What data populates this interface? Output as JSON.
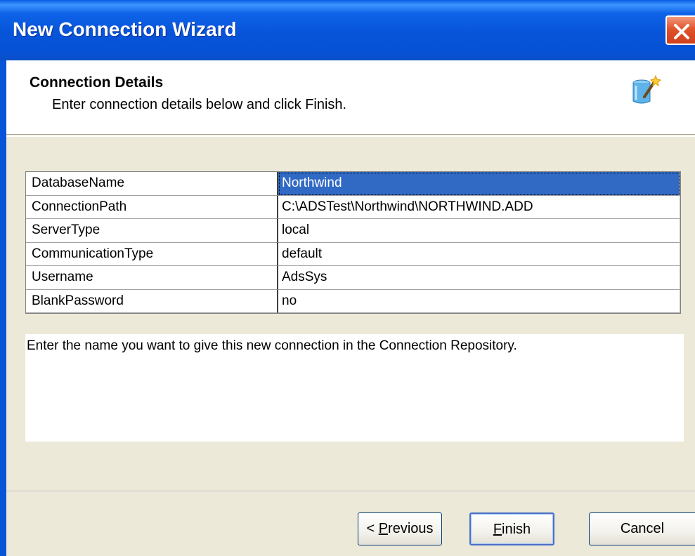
{
  "window": {
    "title": "New Connection Wizard"
  },
  "header": {
    "title": "Connection Details",
    "subtitle": "Enter connection details below and click Finish."
  },
  "properties": [
    {
      "name": "DatabaseName",
      "value": "Northwind",
      "selected": true
    },
    {
      "name": "ConnectionPath",
      "value": "C:\\ADSTest\\Northwind\\NORTHWIND.ADD"
    },
    {
      "name": "ServerType",
      "value": "local"
    },
    {
      "name": "CommunicationType",
      "value": "default"
    },
    {
      "name": "Username",
      "value": "AdsSys"
    },
    {
      "name": "BlankPassword",
      "value": "no"
    }
  ],
  "description": "Enter the name you want to give this new connection in the Connection Repository.",
  "buttons": {
    "previous": {
      "prefix": "< ",
      "mnemonic": "P",
      "rest": "revious"
    },
    "finish": {
      "prefix": "",
      "mnemonic": "F",
      "rest": "inish"
    },
    "cancel": "Cancel"
  },
  "colors": {
    "title_bar": "#0754d9",
    "selection": "#316ac5",
    "dialog_bg": "#ece9d8"
  },
  "icons": {
    "header": "database-wand-icon",
    "close": "close-icon"
  }
}
